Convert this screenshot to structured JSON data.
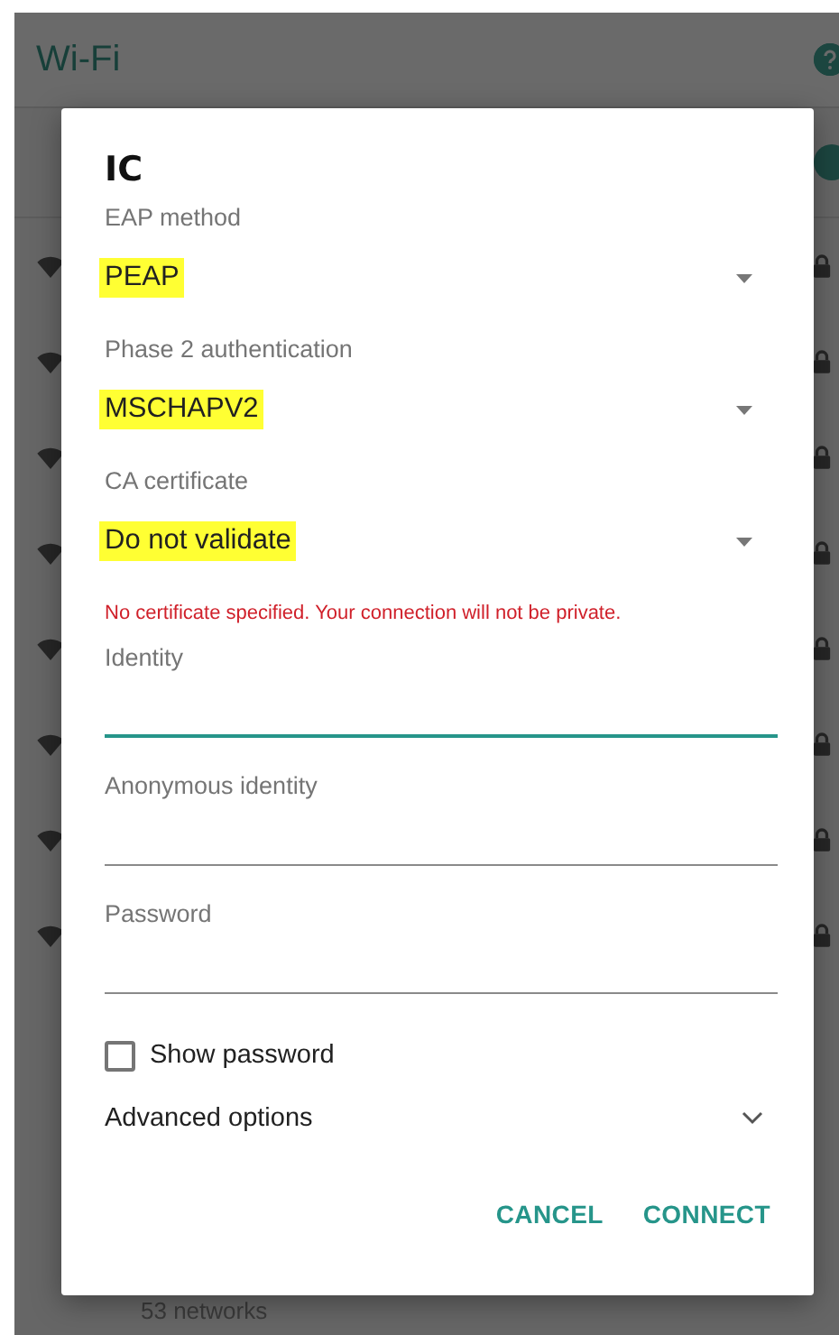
{
  "app_bar": {
    "title": "Wi-Fi"
  },
  "wifi_switch": {
    "on": true
  },
  "network_list": {
    "footer": "53 networks"
  },
  "dialog": {
    "title": "IC",
    "fields": [
      {
        "kind": "dropdown",
        "label": "EAP method",
        "value": "PEAP",
        "highlighted": true
      },
      {
        "kind": "dropdown",
        "label": "Phase 2 authentication",
        "value": "MSCHAPV2",
        "highlighted": true
      },
      {
        "kind": "dropdown",
        "label": "CA certificate",
        "value": "Do not validate",
        "highlighted": true
      },
      {
        "kind": "note",
        "text": "No certificate specified. Your connection will not be private."
      },
      {
        "kind": "text",
        "label": "Identity",
        "focused": true
      },
      {
        "kind": "text",
        "label": "Anonymous identity",
        "focused": false
      },
      {
        "kind": "text",
        "label": "Password",
        "focused": false
      }
    ],
    "show_password": {
      "label": "Show password",
      "checked": false
    },
    "advanced_options": {
      "label": "Advanced options",
      "expanded": false
    },
    "buttons": [
      "CANCEL",
      "CONNECT"
    ]
  }
}
